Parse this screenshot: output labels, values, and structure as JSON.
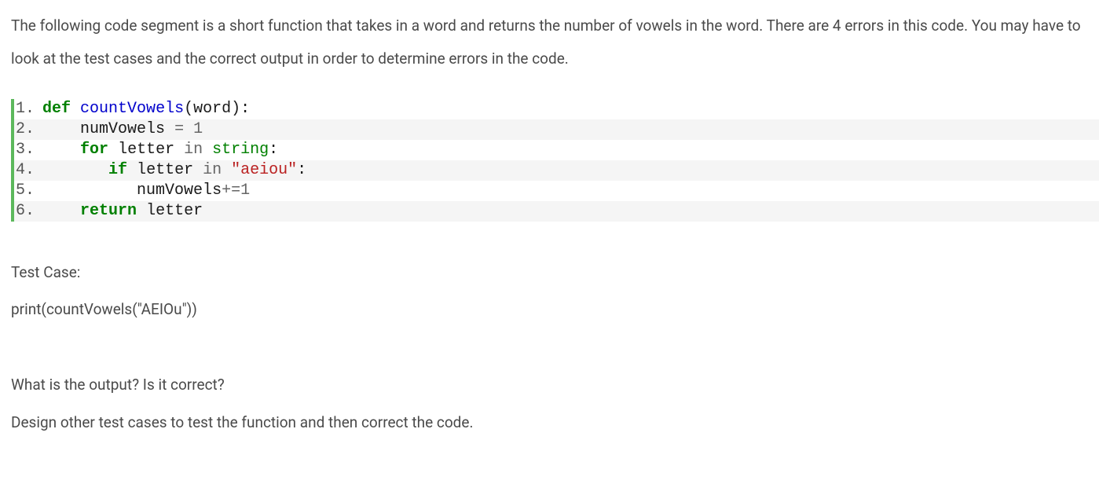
{
  "intro": "The following code segment is a short function that takes in a word and returns the number of vowels in the word. There are 4 errors in this code. You may have to look at the test cases and the correct output in order to determine errors in the code.",
  "code": {
    "lines": [
      {
        "n": "1.",
        "tokens": [
          [
            "kw",
            "def"
          ],
          [
            "sp",
            " "
          ],
          [
            "fn",
            "countVowels"
          ],
          [
            "name",
            "(word):"
          ]
        ]
      },
      {
        "n": "2.",
        "tokens": [
          [
            "sp",
            "    "
          ],
          [
            "name",
            "numVowels "
          ],
          [
            "op",
            "="
          ],
          [
            "sp",
            " "
          ],
          [
            "num",
            "1"
          ]
        ]
      },
      {
        "n": "3.",
        "tokens": [
          [
            "sp",
            "    "
          ],
          [
            "kw",
            "for"
          ],
          [
            "sp",
            " "
          ],
          [
            "name",
            "letter "
          ],
          [
            "op",
            "in"
          ],
          [
            "sp",
            " "
          ],
          [
            "builtin",
            "string"
          ],
          [
            "name",
            ":"
          ]
        ]
      },
      {
        "n": "4.",
        "tokens": [
          [
            "sp",
            "       "
          ],
          [
            "kw",
            "if"
          ],
          [
            "sp",
            " "
          ],
          [
            "name",
            "letter "
          ],
          [
            "op",
            "in"
          ],
          [
            "sp",
            " "
          ],
          [
            "str",
            "\"aeiou\""
          ],
          [
            "name",
            ":"
          ]
        ]
      },
      {
        "n": "5.",
        "tokens": [
          [
            "sp",
            "          "
          ],
          [
            "name",
            "numVowels"
          ],
          [
            "op",
            "+="
          ],
          [
            "num",
            "1"
          ]
        ]
      },
      {
        "n": "6.",
        "tokens": [
          [
            "sp",
            "    "
          ],
          [
            "kw",
            "return"
          ],
          [
            "sp",
            " "
          ],
          [
            "name",
            "letter"
          ]
        ]
      }
    ]
  },
  "testcase_label": "Test Case:",
  "testcase_code": "print(countVowels(\"AEIOu\"))",
  "q1": "What is the output? Is it correct?",
  "q2": "Design other test cases to test the function and then correct the code."
}
